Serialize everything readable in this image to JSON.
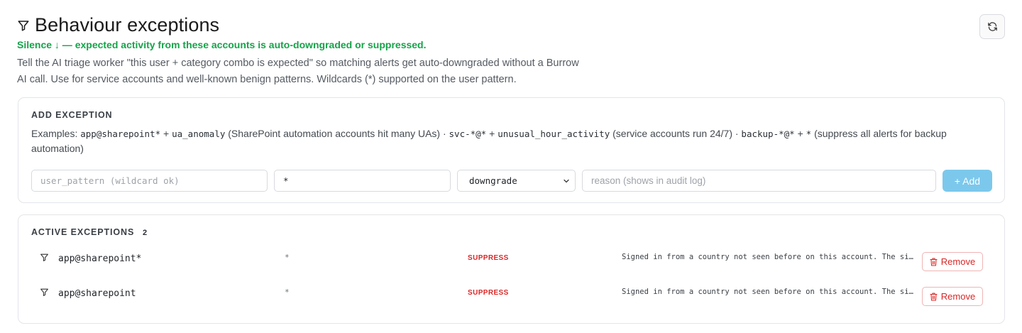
{
  "header": {
    "title": "Behaviour exceptions",
    "subtitle": "Silence ↓ — expected activity from these accounts is auto-downgraded or suppressed.",
    "description": "Tell the AI triage worker \"this user + category combo is expected\" so matching alerts get auto-downgraded without a Burrow AI call. Use for service accounts and well-known benign patterns. Wildcards (*) supported on the user pattern.",
    "refresh_icon": "refresh-icon"
  },
  "add_exception": {
    "heading": "ADD EXCEPTION",
    "examples_prefix": "Examples: ",
    "ex1_user": "app@sharepoint*",
    "ex1_plus": " + ",
    "ex1_cat": "ua_anomaly",
    "ex1_note": " (SharePoint automation accounts hit many UAs) · ",
    "ex2_user": "svc-*@*",
    "ex2_plus": " + ",
    "ex2_cat": "unusual_hour_activity",
    "ex2_note": " (service accounts run 24/7) · ",
    "ex3_user": "backup-*@*",
    "ex3_plus": " + ",
    "ex3_cat": "*",
    "ex3_note": " (suppress all alerts for backup automation)",
    "user_placeholder": "user_pattern (wildcard ok)",
    "category_value": "*",
    "action_selected": "downgrade",
    "reason_placeholder": "reason (shows in audit log)",
    "add_label": "+ Add"
  },
  "active": {
    "heading": "ACTIVE EXCEPTIONS",
    "count": "2",
    "rows": [
      {
        "user": "app@sharepoint*",
        "category": "*",
        "action": "SUPPRESS",
        "reason": "Signed in from a country not seen before on this account. The sign-in matched the expected SharePoint automation pattern.",
        "remove_label": "Remove"
      },
      {
        "user": "app@sharepoint",
        "category": "*",
        "action": "SUPPRESS",
        "reason": "Signed in from a country not seen before on this account. The sign-in matched the expected SharePoint automation pattern.",
        "remove_label": "Remove"
      }
    ]
  },
  "colors": {
    "accent_green": "#16a34a",
    "danger_red": "#dc2626",
    "add_button": "#7cc8ec"
  }
}
